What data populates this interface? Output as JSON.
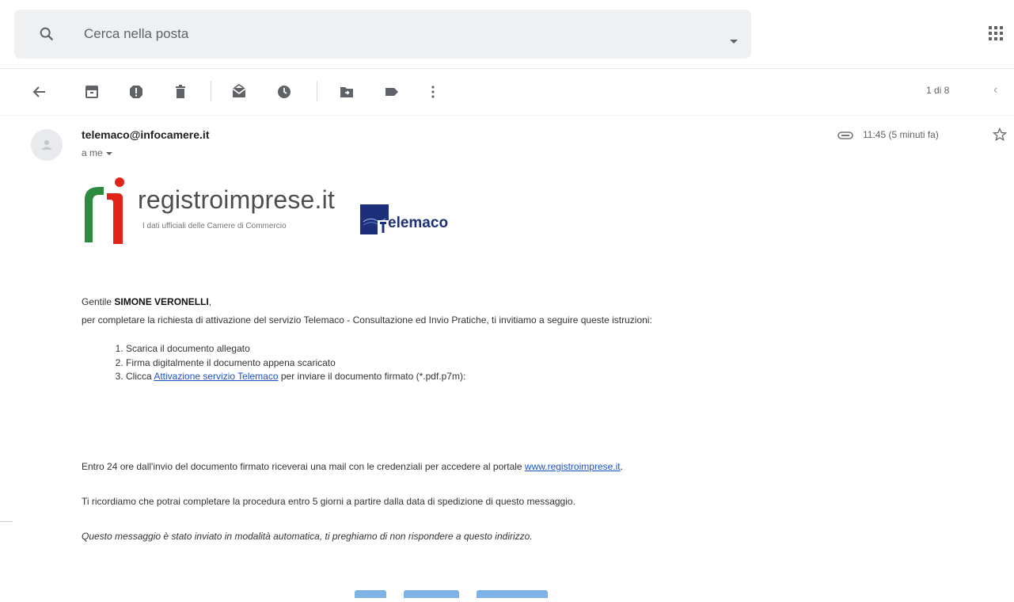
{
  "search": {
    "placeholder": "Cerca nella posta"
  },
  "toolbar": {
    "back_icon": "arrow-back-icon",
    "archive_icon": "archive-icon",
    "spam_icon": "report-spam-icon",
    "delete_icon": "trash-icon",
    "mark_unread_icon": "mark-unread-icon",
    "snooze_icon": "clock-icon",
    "move_icon": "move-to-folder-icon",
    "label_icon": "label-icon",
    "more_icon": "more-vert-icon",
    "pager": "1 di 8",
    "prev_icon": "chevron-left-icon"
  },
  "message": {
    "sender": "telemaco@infocamere.it",
    "to": "a me",
    "time": "11:45 (5 minuti fa)"
  },
  "logos": {
    "registro": "registroimprese.it",
    "registro_sub": "I dati ufficiali delle Camere di Commercio",
    "telemaco": "elemaco"
  },
  "body": {
    "greeting_prefix": "Gentile ",
    "greeting_name": "SIMONE VERONELLI",
    "greeting_suffix": ",",
    "intro": "per completare la richiesta di attivazione del servizio Telemaco - Consultazione ed Invio Pratiche, ti invitiamo a seguire queste istruzioni:",
    "steps": [
      "Scarica il documento allegato",
      "Firma digitalmente il documento appena scaricato"
    ],
    "step3_prefix": "Clicca ",
    "step3_link": "Attivazione servizio Telemaco",
    "step3_suffix": " per inviare il documento firmato (*.pdf.p7m):",
    "line1_prefix": "Entro 24 ore dall'invio del documento firmato riceverai una mail con le credenziali per accedere al portale ",
    "line1_link": "www.registroimprese.it",
    "line1_suffix": ".",
    "line2": "Ti ricordiamo che potrai completare la procedura entro 5 giorni a partire dalla data di spedizione di questo messaggio.",
    "line3": "Questo messaggio è stato inviato in modalità automatica, ti preghiamo di non rispondere a questo indirizzo."
  },
  "colors": {
    "link": "#1a53c5",
    "telemaco_blue": "#1d2f7a",
    "logo_green": "#2e8b3d",
    "logo_red": "#e2231a"
  }
}
